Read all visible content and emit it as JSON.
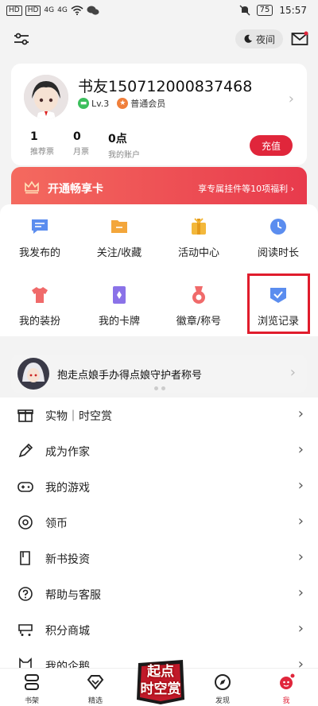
{
  "status_bar": {
    "sim1": "HD",
    "sim2": "HD",
    "net1": "4G",
    "net2": "4G",
    "battery": "75",
    "time": "15:57"
  },
  "top_bar": {
    "night_mode_label": "夜间"
  },
  "profile": {
    "username": "书友150712000837468",
    "level": "Lv.3",
    "member": "普通会员",
    "stats": [
      {
        "value": "1",
        "label": "推荐票"
      },
      {
        "value": "0",
        "label": "月票"
      },
      {
        "value": "0点",
        "label": "我的账户"
      }
    ],
    "recharge_label": "充值"
  },
  "vip": {
    "title": "开通畅享卡",
    "desc": "享专属挂件等10项福利",
    "chevron": "›"
  },
  "grid": [
    {
      "label": "我发布的",
      "icon": "post-icon",
      "color": "#5b8def"
    },
    {
      "label": "关注/收藏",
      "icon": "folder-icon",
      "color": "#f3a63b"
    },
    {
      "label": "活动中心",
      "icon": "gift-icon",
      "color": "#f3b83b"
    },
    {
      "label": "阅读时长",
      "icon": "clock-icon",
      "color": "#5b8def"
    },
    {
      "label": "我的装扮",
      "icon": "shirt-icon",
      "color": "#f06a6a"
    },
    {
      "label": "我的卡牌",
      "icon": "card-icon",
      "color": "#8a72e8"
    },
    {
      "label": "徽章/称号",
      "icon": "medal-icon",
      "color": "#f06a6a"
    },
    {
      "label": "浏览记录",
      "icon": "history-icon",
      "color": "#5b8def"
    }
  ],
  "ad": {
    "text": "抱走点娘手办得点娘守护者称号",
    "chevron": "›"
  },
  "list": [
    {
      "label": "实物｜时空赏",
      "icon": "gift-box-icon"
    },
    {
      "label": "成为作家",
      "icon": "pen-icon"
    },
    {
      "label": "我的游戏",
      "icon": "gamepad-icon"
    },
    {
      "label": "领币",
      "icon": "coin-icon"
    },
    {
      "label": "新书投资",
      "icon": "book-icon"
    },
    {
      "label": "帮助与客服",
      "icon": "help-icon"
    },
    {
      "label": "积分商城",
      "icon": "shop-icon"
    },
    {
      "label": "我的企鹅",
      "icon": "penguin-icon"
    }
  ],
  "list_chevron": "›",
  "tabs": [
    {
      "label": "书架",
      "icon": "bookshelf-icon"
    },
    {
      "label": "精选",
      "icon": "diamond-icon"
    },
    {
      "label": "发现",
      "icon": "compass-icon"
    },
    {
      "label": "我",
      "icon": "me-icon"
    }
  ],
  "promo": {
    "line1": "起点",
    "line2": "时空赏"
  },
  "colors": {
    "accent": "#e0263b",
    "highlight": "#e01c2c"
  }
}
